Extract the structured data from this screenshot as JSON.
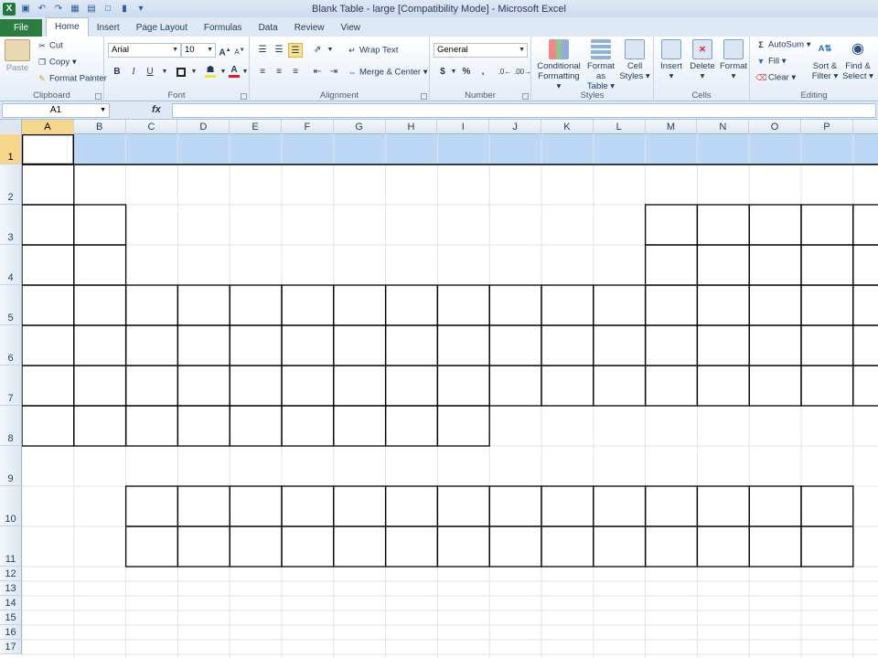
{
  "window": {
    "title": "Blank Table - large  [Compatibility Mode]  -  Microsoft Excel",
    "app_icon": "X"
  },
  "tabs": [
    "File",
    "Home",
    "Insert",
    "Page Layout",
    "Formulas",
    "Data",
    "Review",
    "View"
  ],
  "active_tab": "Home",
  "ribbon": {
    "clipboard": {
      "label": "Clipboard",
      "paste": "Paste",
      "cut": "Cut",
      "copy": "Copy",
      "format_painter": "Format Painter"
    },
    "font": {
      "label": "Font",
      "font_name": "Arial",
      "font_size": "10",
      "bold": "B",
      "italic": "I",
      "underline": "U"
    },
    "alignment": {
      "label": "Alignment",
      "wrap_text": "Wrap Text",
      "merge_center": "Merge & Center"
    },
    "number": {
      "label": "Number",
      "format": "General",
      "currency": "$",
      "percent": "%",
      "comma": ","
    },
    "styles": {
      "label": "Styles",
      "conditional_1": "Conditional",
      "conditional_2": "Formatting",
      "format_table_1": "Format as",
      "format_table_2": "Table",
      "cell_styles_1": "Cell",
      "cell_styles_2": "Styles"
    },
    "cells": {
      "label": "Cells",
      "insert": "Insert",
      "delete": "Delete",
      "format": "Format"
    },
    "editing": {
      "label": "Editing",
      "autosum": "AutoSum",
      "fill": "Fill",
      "clear": "Clear",
      "sort_1": "Sort &",
      "sort_2": "Filter",
      "find_1": "Find &",
      "find_2": "Select"
    }
  },
  "formula_bar": {
    "name_box": "A1",
    "fx": "fx",
    "value": ""
  },
  "sheet": {
    "columns": [
      "A",
      "B",
      "C",
      "D",
      "E",
      "F",
      "G",
      "H",
      "I",
      "J",
      "K",
      "L",
      "M",
      "N",
      "O",
      "P"
    ],
    "rows": [
      "1",
      "2",
      "3",
      "4",
      "5",
      "6",
      "7",
      "8",
      "9",
      "10",
      "11",
      "12",
      "13",
      "14",
      "15",
      "16",
      "17"
    ],
    "selected_cell": "A1",
    "header_fill_color": "#bdd7f7",
    "table_layout": {
      "1": [],
      "2": [
        1
      ],
      "3": [
        1,
        2,
        13,
        14,
        15,
        16
      ],
      "4": [
        1,
        2,
        13,
        14,
        15,
        16
      ],
      "5": [
        1,
        2,
        3,
        4,
        5,
        6,
        7,
        8,
        9,
        10,
        11,
        12,
        13,
        14,
        15,
        16
      ],
      "6": [
        1,
        2,
        3,
        4,
        5,
        6,
        7,
        8,
        9,
        10,
        11,
        12,
        13,
        14,
        15,
        16
      ],
      "7": [
        1,
        2,
        3,
        4,
        5,
        6,
        7,
        8,
        9,
        10,
        11,
        12,
        13,
        14,
        15,
        16
      ],
      "8": [
        1,
        2,
        3,
        4,
        5,
        6,
        7,
        8,
        9
      ],
      "10": [
        3,
        4,
        5,
        6,
        7,
        8,
        9,
        10,
        11,
        12,
        13,
        14,
        15,
        16
      ],
      "11": [
        3,
        4,
        5,
        6,
        7,
        8,
        9,
        10,
        11,
        12,
        13,
        14,
        15,
        16
      ]
    }
  }
}
